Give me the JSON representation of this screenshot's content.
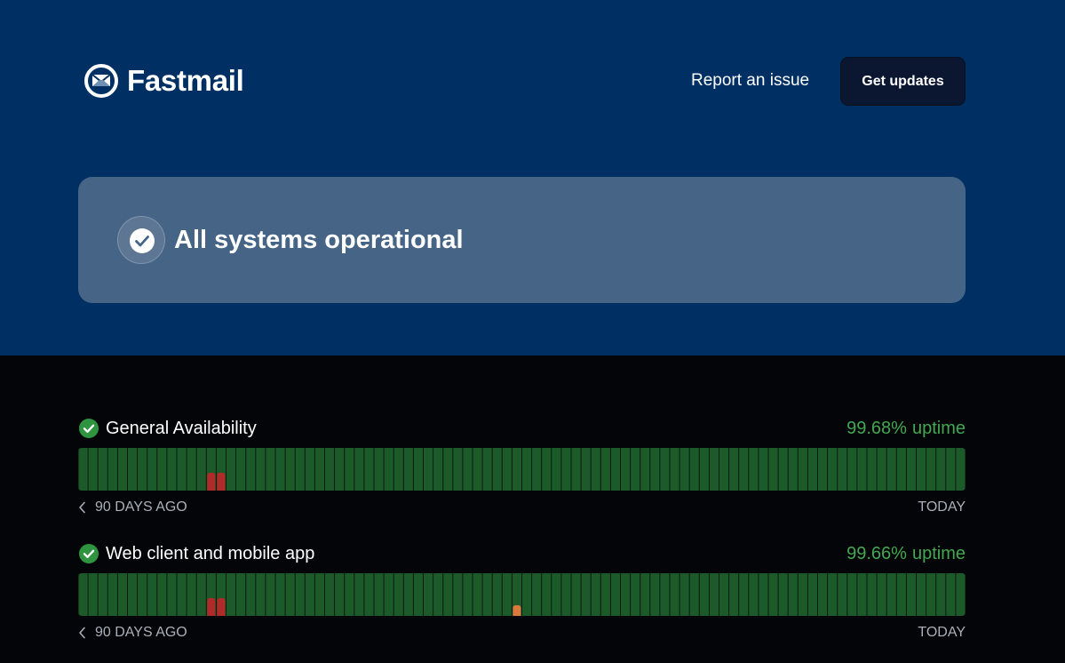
{
  "header": {
    "brand": "Fastmail",
    "report_label": "Report an issue",
    "updates_label": "Get updates"
  },
  "status": {
    "message": "All systems operational"
  },
  "colors": {
    "hero_bg": "#003063",
    "card_bg": "#466486",
    "day_ok": "#1c5a2a",
    "day_major": "#b12a2a",
    "day_minor": "#d9793b",
    "uptime_text": "#44a852"
  },
  "components": [
    {
      "name": "General Availability",
      "uptime_value": "99.68%",
      "uptime_label": "uptime",
      "range_start": "90 DAYS AGO",
      "range_end": "TODAY",
      "days": 90,
      "incidents": [
        {
          "day": 13,
          "severity": "major",
          "level": 0.42
        },
        {
          "day": 14,
          "severity": "major",
          "level": 0.42
        }
      ]
    },
    {
      "name": "Web client and mobile app",
      "uptime_value": "99.66%",
      "uptime_label": "uptime",
      "range_start": "90 DAYS AGO",
      "range_end": "TODAY",
      "days": 90,
      "incidents": [
        {
          "day": 13,
          "severity": "major",
          "level": 0.42
        },
        {
          "day": 14,
          "severity": "major",
          "level": 0.42
        },
        {
          "day": 44,
          "severity": "minor",
          "level": 0.25
        }
      ]
    }
  ]
}
